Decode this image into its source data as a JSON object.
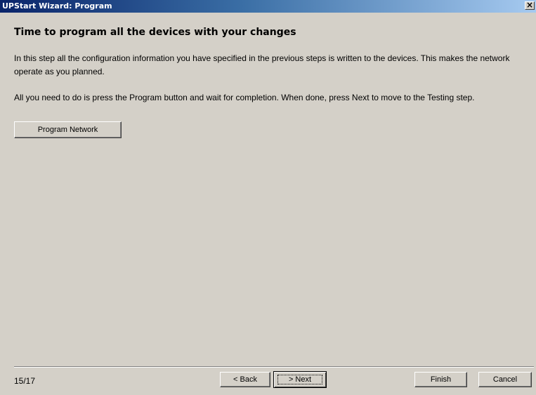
{
  "window": {
    "title": "UPStart Wizard: Program",
    "close_icon": "close-icon"
  },
  "content": {
    "heading": "Time to program all the devices with your changes",
    "paragraph1": "In this step all the configuration information you have specified in the previous steps is written to the devices. This makes the network operate as you planned.",
    "paragraph2": "All you need to do is press the Program button and wait for completion. When done, press Next to move to the Testing step.",
    "program_button": "Program Network"
  },
  "footer": {
    "step_counter": "15/17",
    "back_label": "< Back",
    "next_label": "> Next",
    "finish_label": "Finish",
    "cancel_label": "Cancel"
  }
}
